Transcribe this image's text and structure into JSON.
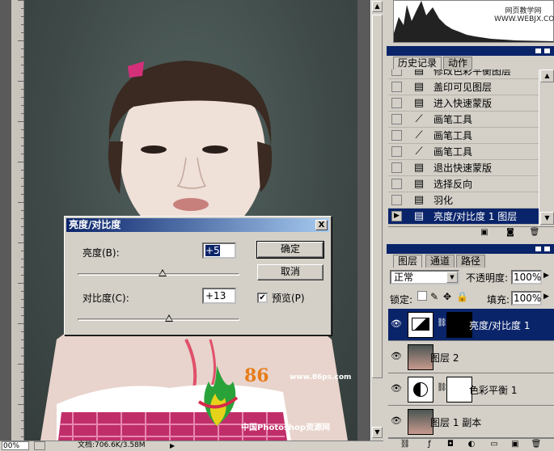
{
  "status_bar": {
    "zoom": "00%",
    "document_info": "文档:706.6K/3.58M"
  },
  "dialog": {
    "title": "亮度/对比度",
    "close": "X",
    "brightness_label": "亮度(B):",
    "brightness_value": "+5",
    "brightness_fraction": 0.52,
    "contrast_label": "对比度(C):",
    "contrast_value": "+13",
    "contrast_fraction": 0.56,
    "ok": "确定",
    "cancel": "取消",
    "preview_label": "预览(P)",
    "preview_checked": true
  },
  "history": {
    "tabs": [
      "历史记录",
      "动作"
    ],
    "items": [
      {
        "label": "修改色彩平衡图层",
        "icon": "document-step-icon"
      },
      {
        "label": "盖印可见图层",
        "icon": "document-step-icon"
      },
      {
        "label": "进入快速蒙版",
        "icon": "document-step-icon"
      },
      {
        "label": "画笔工具",
        "icon": "brush-icon"
      },
      {
        "label": "画笔工具",
        "icon": "brush-icon"
      },
      {
        "label": "画笔工具",
        "icon": "brush-icon"
      },
      {
        "label": "退出快速蒙版",
        "icon": "document-step-icon"
      },
      {
        "label": "选择反向",
        "icon": "document-step-icon"
      },
      {
        "label": "羽化",
        "icon": "document-step-icon"
      },
      {
        "label": "亮度/对比度 1 图层",
        "icon": "document-step-icon",
        "selected": true
      }
    ]
  },
  "layers": {
    "tabs": [
      "图层",
      "通道",
      "路径"
    ],
    "blend_mode": "正常",
    "opacity_label": "不透明度:",
    "opacity_value": "100%",
    "lock_label": "锁定:",
    "fill_label": "填充:",
    "fill_value": "100%",
    "items": [
      {
        "name": "亮度/对比度 1",
        "type": "adjustment",
        "selected": true
      },
      {
        "name": "图层 2",
        "type": "pixel"
      },
      {
        "name": "色彩平衡 1",
        "type": "adjustment"
      },
      {
        "name": "图层 1 副本",
        "type": "pixel"
      }
    ]
  },
  "watermark": {
    "number": "86",
    "url": "www.86ps.com",
    "caption": "中国Photoshop资源网",
    "site_top": "网页教学网",
    "site_top_url": "WWW.WEBJX.COM"
  },
  "colors": {
    "selection_blue": "#0a246a",
    "dialog_gray": "#d4d0c8",
    "watermark_orange": "#e67c1a"
  }
}
